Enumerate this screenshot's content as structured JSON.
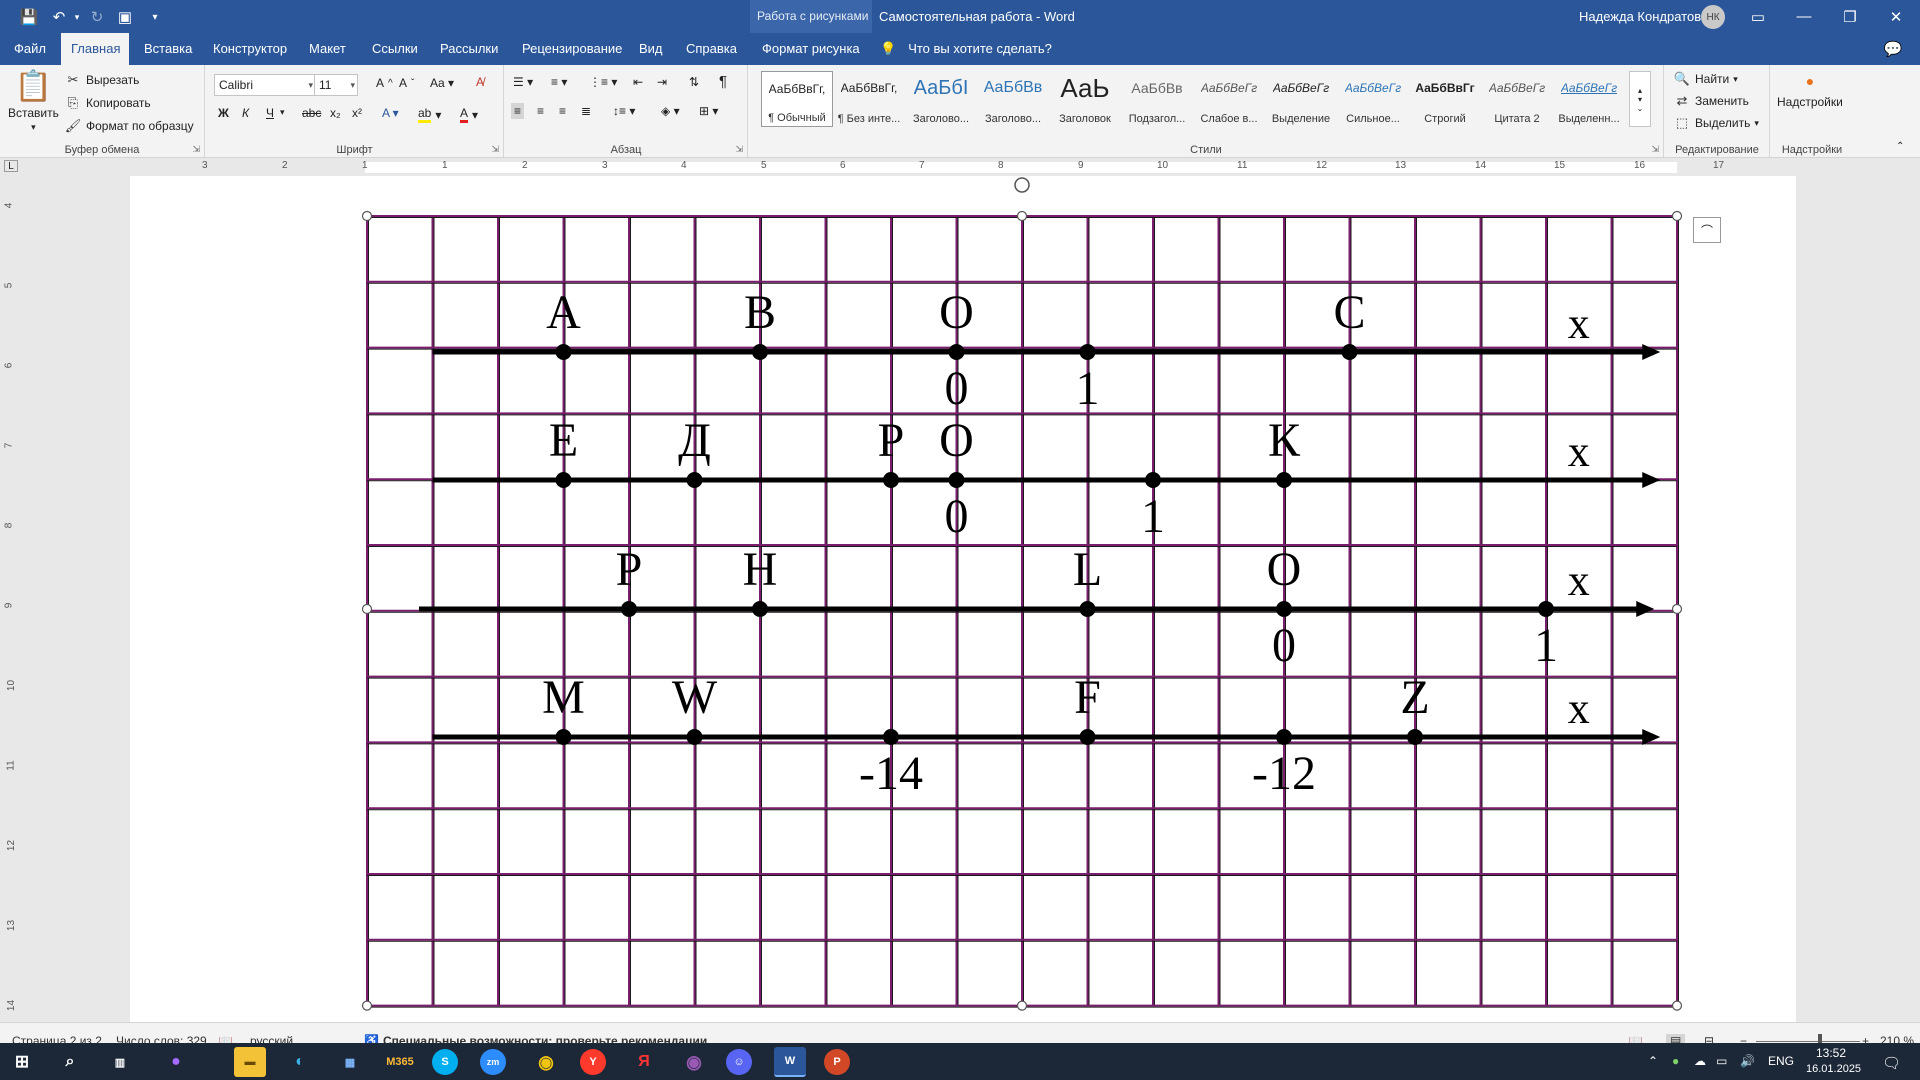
{
  "titlebar": {
    "context_label": "Работа с рисунками",
    "document_title": "Самостоятельная работа  -  Word",
    "user_name": "Надежда Кондратова",
    "user_initials": "НК"
  },
  "tabs": [
    "Файл",
    "Главная",
    "Вставка",
    "Конструктор",
    "Макет",
    "Ссылки",
    "Рассылки",
    "Рецензирование",
    "Вид",
    "Справка",
    "Формат рисунка"
  ],
  "active_tab": "Главная",
  "tell_me": "Что вы хотите сделать?",
  "clipboard": {
    "paste": "Вставить",
    "cut": "Вырезать",
    "copy": "Копировать",
    "format_painter": "Формат по образцу",
    "group_label": "Буфер обмена"
  },
  "font": {
    "family": "Calibri",
    "size": "11",
    "group_label": "Шрифт",
    "bold": "Ж",
    "italic": "К",
    "underline": "Ч"
  },
  "paragraph": {
    "group_label": "Абзац"
  },
  "styles": {
    "group_label": "Стили",
    "items": [
      {
        "preview": "АаБбВвГг,",
        "name": "¶ Обычный"
      },
      {
        "preview": "АаБбВвГг,",
        "name": "¶ Без инте..."
      },
      {
        "preview": "АаБбI",
        "name": "Заголово..."
      },
      {
        "preview": "АаБбВв",
        "name": "Заголово..."
      },
      {
        "preview": "АаЬ",
        "name": "Заголовок"
      },
      {
        "preview": "АаБбВв",
        "name": "Подзагол..."
      },
      {
        "preview": "АаБбВеГг",
        "name": "Слабое в..."
      },
      {
        "preview": "АаБбВеГг",
        "name": "Выделение"
      },
      {
        "preview": "АаБбВеГг",
        "name": "Сильное..."
      },
      {
        "preview": "АаБбВвГг",
        "name": "Строгий"
      },
      {
        "preview": "АаБбВеГг",
        "name": "Цитата 2"
      },
      {
        "preview": "АаБбВеГг",
        "name": "Выделенн..."
      }
    ]
  },
  "editing": {
    "group_label": "Редактирование",
    "find": "Найти",
    "replace": "Заменить",
    "select": "Выделить"
  },
  "addins": {
    "label": "Надстройки",
    "group_label": "Надстройки"
  },
  "ruler_marks": [
    "3",
    "2",
    "1",
    "1",
    "2",
    "3",
    "4",
    "5",
    "6",
    "7",
    "8",
    "9",
    "10",
    "11",
    "12",
    "13",
    "14",
    "15",
    "16",
    "17"
  ],
  "vruler_marks": [
    "4",
    "5",
    "6",
    "7",
    "8",
    "9",
    "10",
    "11",
    "12",
    "13",
    "14"
  ],
  "figure": {
    "axis_label": "x",
    "lines": [
      {
        "points": [
          {
            "label": "A",
            "col": 3
          },
          {
            "label": "B",
            "col": 6
          },
          {
            "label": "O",
            "col": 9
          },
          {
            "label": "C",
            "col": 15
          }
        ],
        "ticks": [
          {
            "text": "0",
            "col": 9
          },
          {
            "text": "1",
            "col": 11
          }
        ],
        "extra_dots": [
          11
        ]
      },
      {
        "points": [
          {
            "label": "E",
            "col": 3
          },
          {
            "label": "Д",
            "col": 5
          },
          {
            "label": "P",
            "col": 8
          },
          {
            "label": "O",
            "col": 9
          },
          {
            "label": "К",
            "col": 14
          }
        ],
        "ticks": [
          {
            "text": "0",
            "col": 9
          },
          {
            "text": "1",
            "col": 12
          }
        ],
        "extra_dots": [
          12
        ]
      },
      {
        "points": [
          {
            "label": "P",
            "col": 4
          },
          {
            "label": "H",
            "col": 6
          },
          {
            "label": "L",
            "col": 11
          },
          {
            "label": "O",
            "col": 14
          }
        ],
        "ticks": [
          {
            "text": "0",
            "col": 14
          },
          {
            "text": "1",
            "col": 18
          }
        ],
        "extra_dots": [
          18
        ]
      },
      {
        "points": [
          {
            "label": "M",
            "col": 3
          },
          {
            "label": "W",
            "col": 5
          },
          {
            "label": "F",
            "col": 11
          },
          {
            "label": "Z",
            "col": 16
          }
        ],
        "ticks": [
          {
            "text": "-14",
            "col": 8
          },
          {
            "text": "-12",
            "col": 14
          }
        ],
        "extra_dots": [
          8,
          14
        ]
      }
    ]
  },
  "status": {
    "page": "Страница 2 из 2",
    "words": "Число слов: 329",
    "language": "русский",
    "accessibility": "Специальные возможности: проверьте рекомендации",
    "zoom": "210 %"
  },
  "taskbar": {
    "lang": "ENG",
    "time": "13:52",
    "date": "16.01.2025"
  }
}
